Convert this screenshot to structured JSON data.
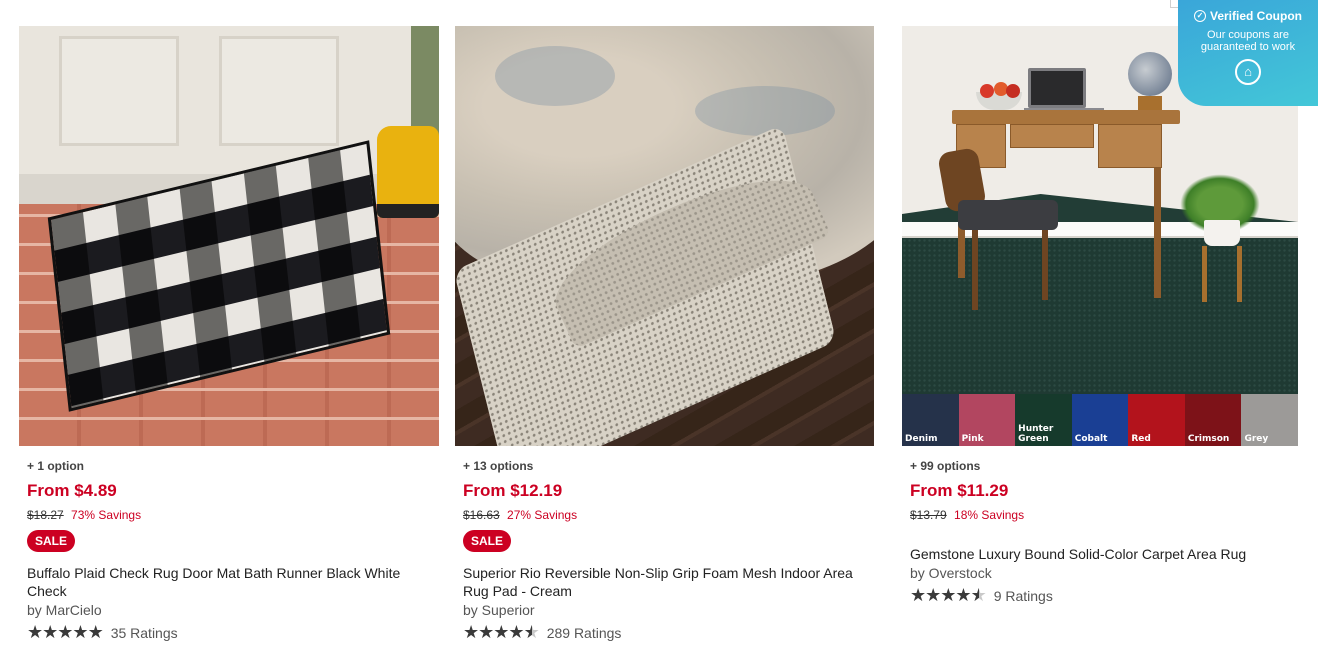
{
  "products": [
    {
      "options": "+ 1 option",
      "price": "From $4.89",
      "original_price": "$18.27",
      "savings": "73% Savings",
      "sale_badge": "SALE",
      "title": "Buffalo Plaid Check Rug Door Mat Bath Runner Black White Check",
      "brand": "by MarCielo",
      "rating": 5,
      "ratings_count": "35 Ratings"
    },
    {
      "options": "+ 13 options",
      "price": "From $12.19",
      "original_price": "$16.63",
      "savings": "27% Savings",
      "sale_badge": "SALE",
      "title": "Superior Rio Reversible Non-Slip Grip Foam Mesh Indoor Area Rug Pad - Cream",
      "brand": "by Superior",
      "rating": 4.5,
      "ratings_count": "289 Ratings"
    },
    {
      "options": "+ 99 options",
      "price": "From $11.29",
      "original_price": "$13.79",
      "savings": "18% Savings",
      "title": "Gemstone Luxury Bound Solid-Color Carpet Area Rug",
      "brand": "by Overstock",
      "rating": 4.5,
      "ratings_count": "9 Ratings",
      "swatches": [
        {
          "label": "Denim",
          "color": "#25324a"
        },
        {
          "label": "Pink",
          "color": "#b24660"
        },
        {
          "label": "Hunter Green",
          "color": "#163a2c"
        },
        {
          "label": "Cobalt",
          "color": "#1a3f94"
        },
        {
          "label": "Red",
          "color": "#b3131c"
        },
        {
          "label": "Crimson",
          "color": "#7d1218"
        },
        {
          "label": "Grey",
          "color": "#9c9a98"
        }
      ]
    }
  ],
  "coupon_popup": {
    "title": "Verified Coupon",
    "subtitle": "Our coupons are guaranteed to work",
    "icon": "check-circle-icon",
    "logo_icon": "cap-logo-icon"
  },
  "colors": {
    "sale_red": "#cc0022",
    "coupon_gradient_start": "#3aa6d9",
    "coupon_gradient_end": "#43c7d8"
  }
}
